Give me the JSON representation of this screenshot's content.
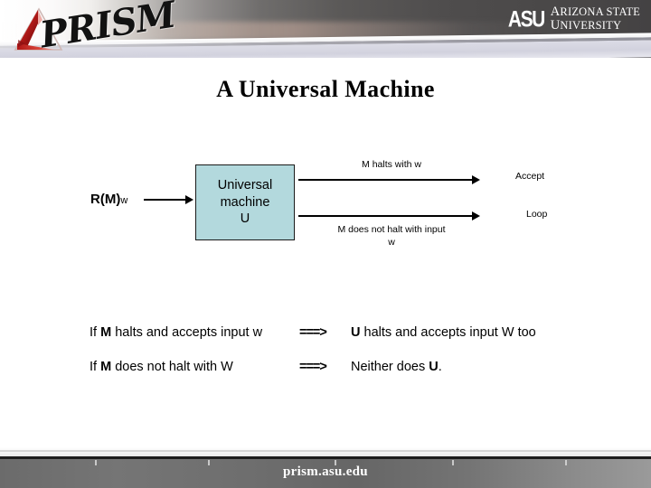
{
  "header": {
    "prism_logo_text": "PRISM",
    "prism_icon": "red-prism-triangle-icon",
    "asu_mark": "ASU",
    "asu_line1_big": "A",
    "asu_line1_rest": "RIZONA ",
    "asu_line1_big2": "S",
    "asu_line1_rest2": "TATE",
    "asu_line2_big": "U",
    "asu_line2_rest": "NIVERSITY"
  },
  "title": "A Universal Machine",
  "diagram": {
    "input_label_main": "R(M)",
    "input_label_sub": "w",
    "box_line1": "Universal",
    "box_line2": "machine",
    "box_line3": "U",
    "box_fill": "#b3d9dd",
    "box_border": "#1a1a1a",
    "top_branch_label": "M  halts with w",
    "bottom_branch_label_line1": "M does not halt with input",
    "bottom_branch_label_line2": "w",
    "top_outcome": "Accept",
    "bottom_outcome": "Loop"
  },
  "implications": [
    {
      "left_prefix": "If ",
      "left_bold": "M",
      "left_rest": " halts and accepts input w",
      "arrow": "===>",
      "right_bold": "U",
      "right_rest": " halts and accepts input W too"
    },
    {
      "left_prefix": "If ",
      "left_bold": "M",
      "left_rest": " does not halt with W",
      "arrow": "===>",
      "right_prefix": "Neither does ",
      "right_bold": "U",
      "right_rest": "."
    }
  ],
  "footer": {
    "url": "prism.asu.edu"
  }
}
